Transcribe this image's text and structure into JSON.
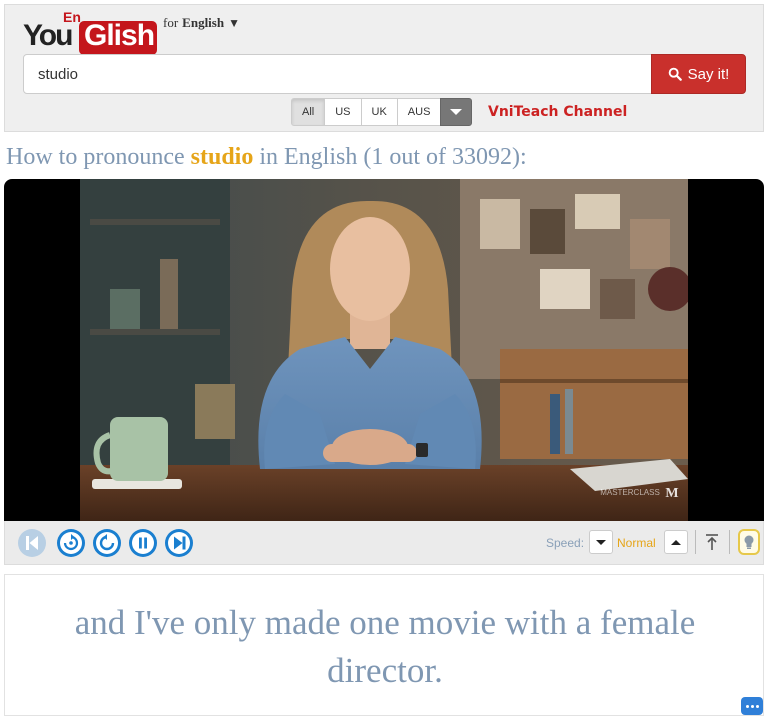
{
  "header": {
    "logo": {
      "you": "You",
      "glish": "Glish",
      "en": "En"
    },
    "language_selector": {
      "prefix": "for",
      "language": "English",
      "caret": "▼"
    },
    "search": {
      "value": "studio",
      "placeholder": ""
    },
    "say_button": {
      "label": "Say it!",
      "icon": "search-icon"
    },
    "accents": [
      {
        "label": "All",
        "active": true
      },
      {
        "label": "US",
        "active": false
      },
      {
        "label": "UK",
        "active": false
      },
      {
        "label": "AUS",
        "active": false
      }
    ],
    "channel": "VniTeach Channel"
  },
  "result": {
    "prefix": "How to pronounce",
    "term": "studio",
    "suffix": "in English (1 out of 33092):"
  },
  "video": {
    "watermark": "MASTERCLASS"
  },
  "controls": {
    "buttons": [
      "previous-icon",
      "replay-slow-icon",
      "replay-icon",
      "pause-icon",
      "next-icon"
    ],
    "speed_label": "Speed:",
    "speed_value": "Normal"
  },
  "caption": {
    "text": "and I've only made one movie with a female director."
  },
  "colors": {
    "brand_red": "#c4161c",
    "accent_orange": "#e6a519",
    "caption_blue": "#7f97b2",
    "control_blue": "#1a7fd0"
  }
}
